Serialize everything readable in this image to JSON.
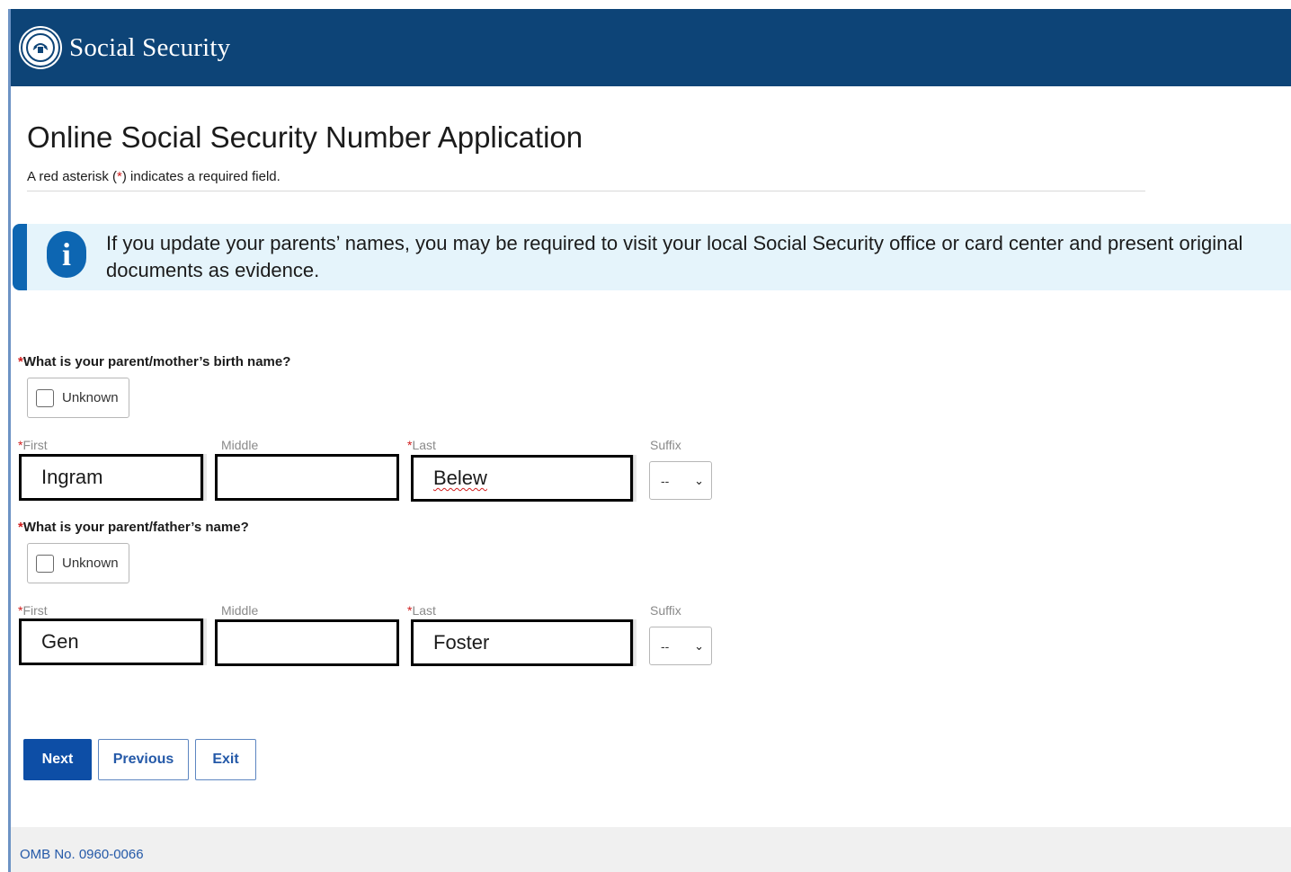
{
  "header": {
    "brand": "Social Security",
    "seal_icon": "ssa-seal-icon",
    "bg_color": "#0d4477"
  },
  "page": {
    "title": "Online Social Security Number Application",
    "required_note_prefix": "A red asterisk (",
    "required_note_star": "*",
    "required_note_suffix": ") indicates a required field."
  },
  "info": {
    "icon": "info-icon",
    "text": "If you update your parents’ names, you may be required to visit your local Social Security office or card center and present original documents as evidence."
  },
  "mother": {
    "question": "What is your parent/mother’s birth name?",
    "unknown_label": "Unknown",
    "unknown_checked": false,
    "first_label": "First",
    "middle_label": "Middle",
    "last_label": "Last",
    "suffix_label": "Suffix",
    "first_value": "Ingram",
    "middle_value": "",
    "last_value": "Belew",
    "suffix_value": "--"
  },
  "father": {
    "question": "What is your parent/father’s name?",
    "unknown_label": "Unknown",
    "unknown_checked": false,
    "first_label": "First",
    "middle_label": "Middle",
    "last_label": "Last",
    "suffix_label": "Suffix",
    "first_value": "Gen",
    "middle_value": "",
    "last_value": "Foster",
    "suffix_value": "--"
  },
  "buttons": {
    "next": "Next",
    "previous": "Previous",
    "exit": "Exit"
  },
  "footer": {
    "omb": "OMB No. 0960-0066"
  },
  "required_star": "*"
}
